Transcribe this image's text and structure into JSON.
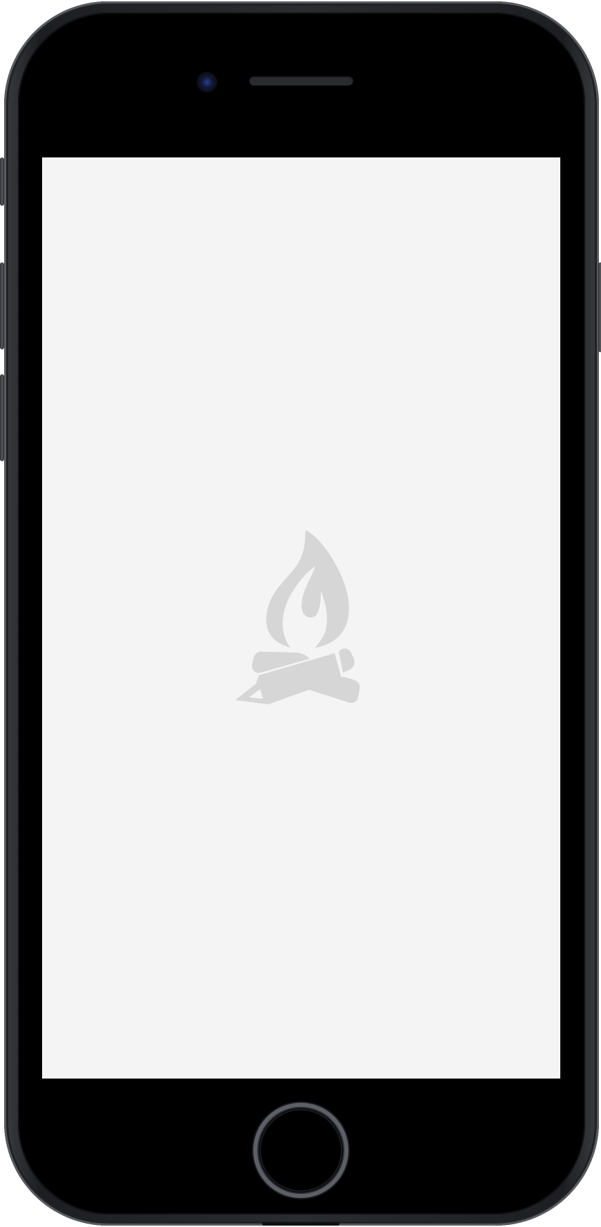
{
  "device": {
    "frame_color": "#2b2c30",
    "bezel_color": "#000000"
  },
  "screen": {
    "background": "#f4f4f4",
    "logo": {
      "icon": "campfire-icon",
      "color": "#d6d6d6"
    }
  }
}
